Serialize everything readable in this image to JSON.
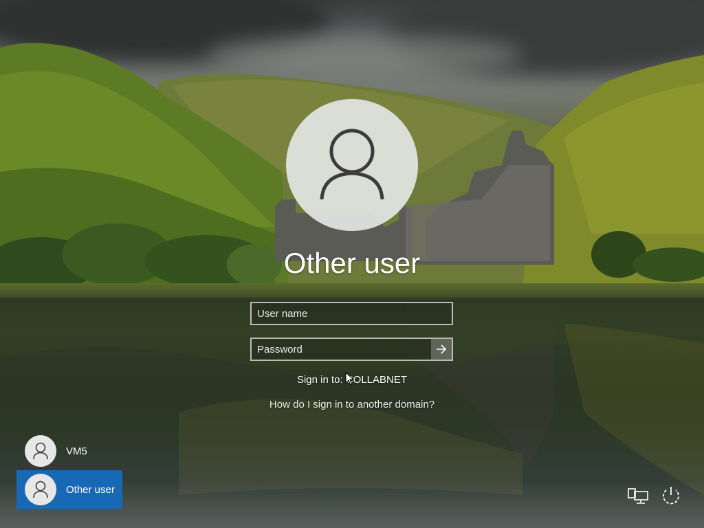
{
  "login": {
    "title": "Other user",
    "username_placeholder": "User name",
    "password_placeholder": "Password",
    "signin_to": "Sign in to: COLLABNET",
    "domain_help_link": "How do I sign in to another domain?"
  },
  "users": [
    {
      "name": "VM5",
      "selected": false
    },
    {
      "name": "Other user",
      "selected": true
    }
  ],
  "icons": {
    "avatar": "person-icon",
    "submit": "arrow-right-icon",
    "network": "network-icon",
    "power": "power-icon"
  },
  "colors": {
    "selected_tile": "#1768b5",
    "avatar_bg": "#e4e6e4"
  }
}
